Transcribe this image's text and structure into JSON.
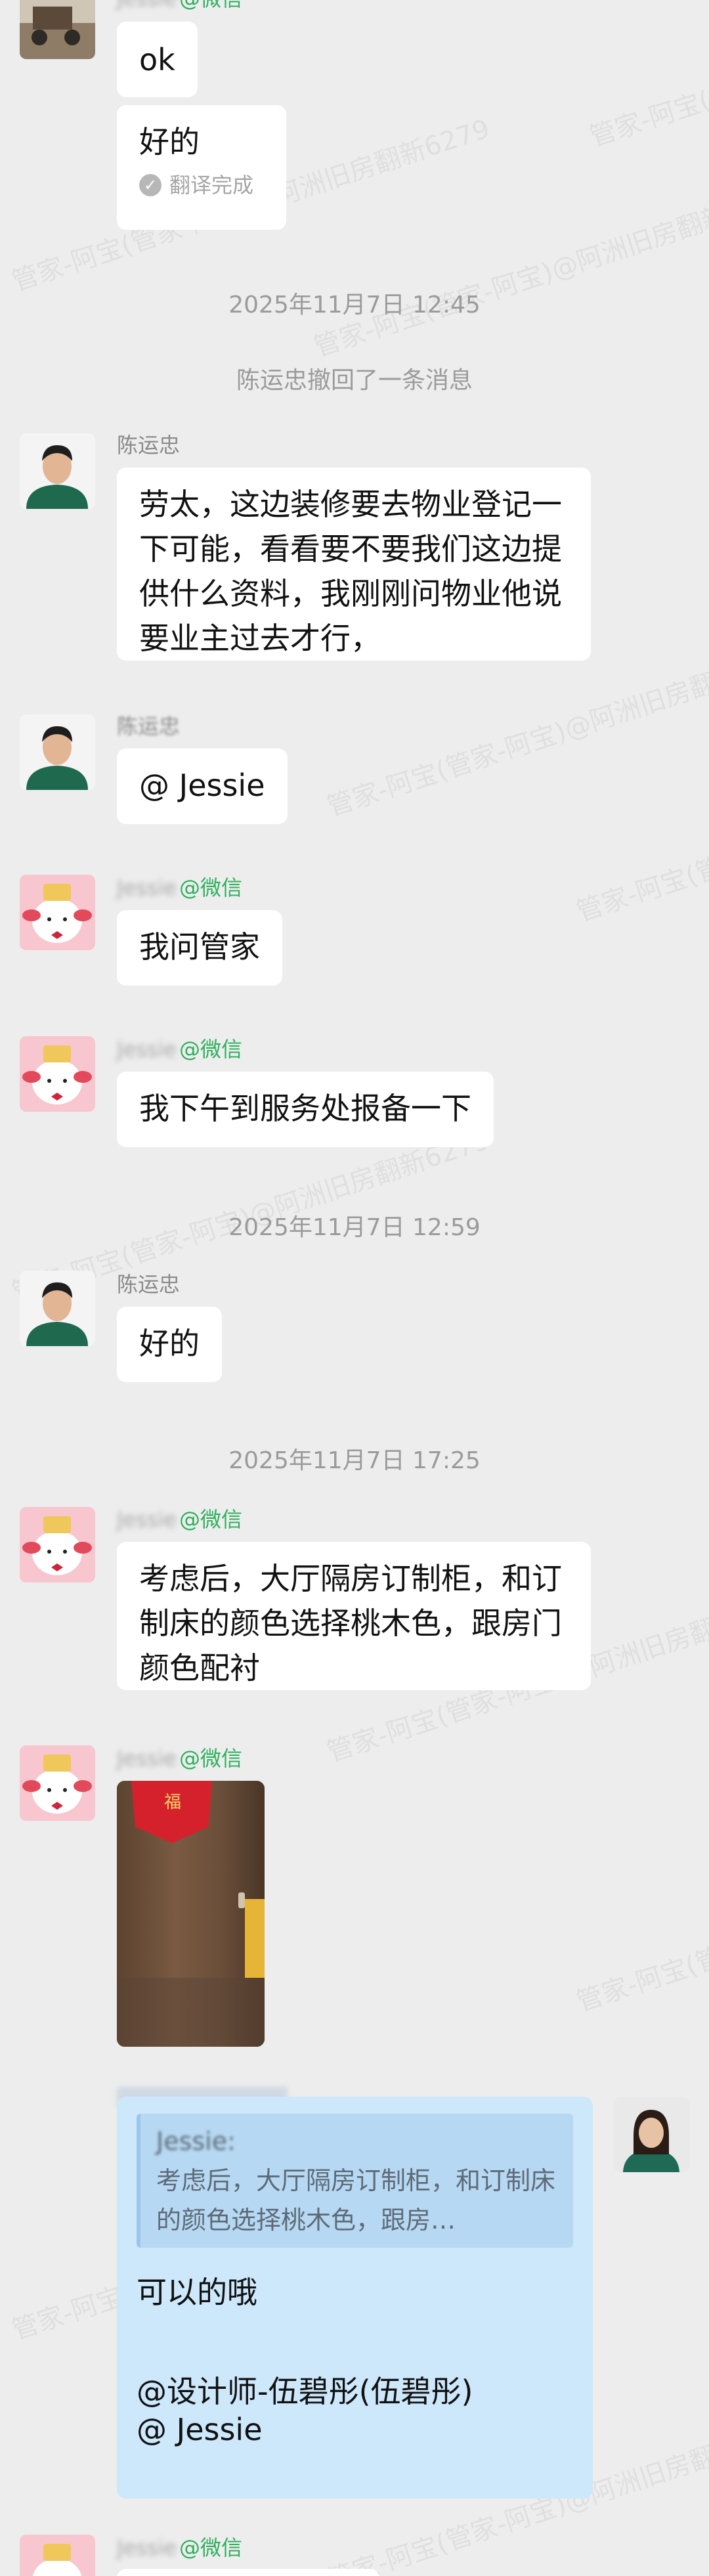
{
  "watermark_text": "管家-阿宝(管家-阿宝)@阿洲旧房翻新6279",
  "messages": {
    "top_sender_source": "@微信",
    "top_ok": "ok",
    "top_hao": "好的",
    "top_translate": "翻译完成",
    "ts1": "2025年11月7日  12:45",
    "recall": "陈运忠撤回了一条消息",
    "chen_name": "陈运忠",
    "chen_msg1": "劳太，这边装修要去物业登记一下可能，看看要不要我们这边提供什么资料，我刚刚问物业他说要业主过去才行，",
    "chen_name2": "陈运忠",
    "chen_msg2": "@ Jessie",
    "jessie_name": "Jessie",
    "source_wechat": "@微信",
    "jessie_msg1": "我问管家",
    "jessie_msg2": "我下午到服务处报备一下",
    "ts2": "2025年11月7日  12:59",
    "chen_msg3": "好的",
    "ts3": "2025年11月7日  17:25",
    "jessie_msg3": "考虑后，大厅隔房订制柜，和订制床的颜色选择桃木色，跟房门颜色配衬",
    "photo_sign": "福",
    "reply_quote_name": "Jessie:",
    "reply_quote_text": "考虑后，大厅隔房订制柜，和订制床的颜色选择桃木色，跟房…",
    "reply_line1": "可以的哦",
    "reply_line2": " @设计师-伍碧彤(伍碧彤)",
    "reply_line3": "@ Jessie"
  },
  "colors": {
    "background": "#ededed",
    "bubble": "#ffffff",
    "bubble_self": "#cde7fb",
    "wechat_green": "#2fb05d",
    "timestamp": "#9b9b9b"
  }
}
